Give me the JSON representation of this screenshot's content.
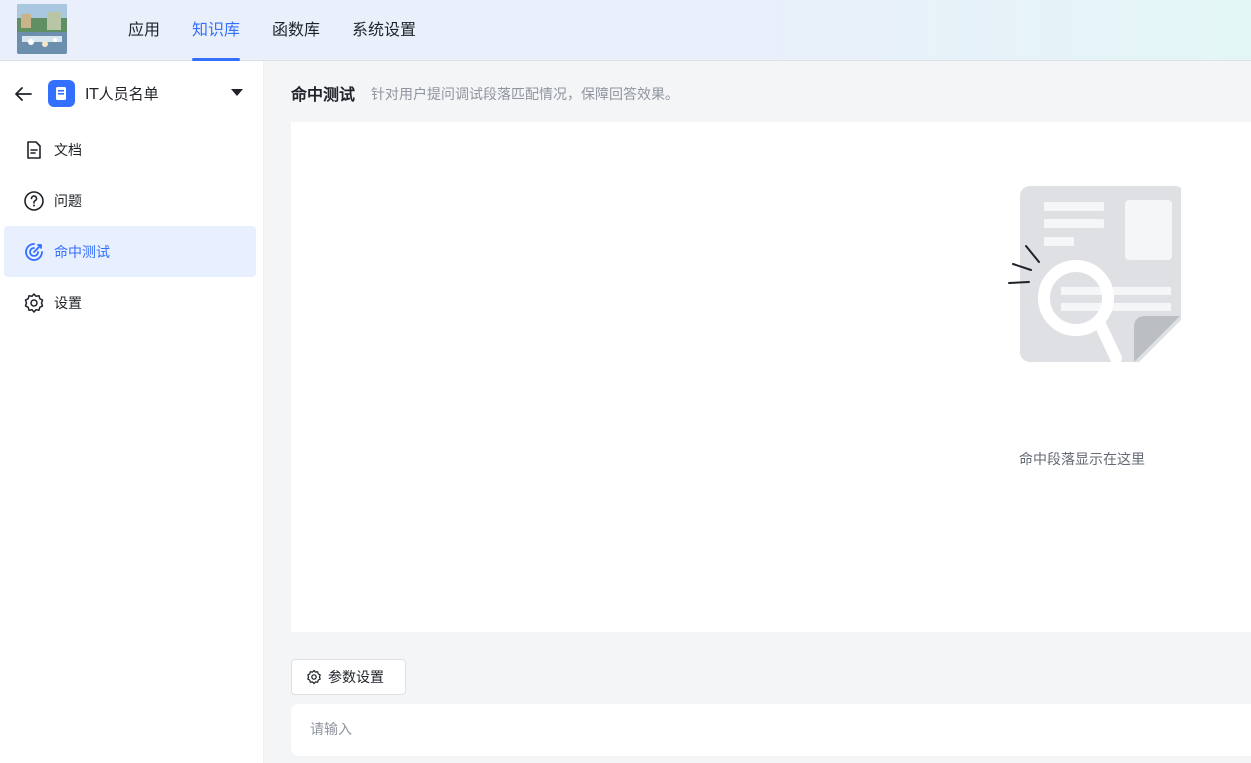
{
  "header": {
    "nav": [
      {
        "label": "应用",
        "active": false
      },
      {
        "label": "知识库",
        "active": true
      },
      {
        "label": "函数库",
        "active": false
      },
      {
        "label": "系统设置",
        "active": false
      }
    ]
  },
  "sidebar": {
    "kb_name": "IT人员名单",
    "items": [
      {
        "label": "文档",
        "icon": "document-icon",
        "active": false
      },
      {
        "label": "问题",
        "icon": "question-icon",
        "active": false
      },
      {
        "label": "命中测试",
        "icon": "target-icon",
        "active": true
      },
      {
        "label": "设置",
        "icon": "gear-icon",
        "active": false
      }
    ]
  },
  "main": {
    "title": "命中测试",
    "description": "针对用户提问调试段落匹配情况，保障回答效果。",
    "empty_text": "命中段落显示在这里",
    "param_button": "参数设置",
    "input_placeholder": "请输入"
  },
  "colors": {
    "accent": "#3370ff",
    "active_bg": "#e8efff"
  }
}
